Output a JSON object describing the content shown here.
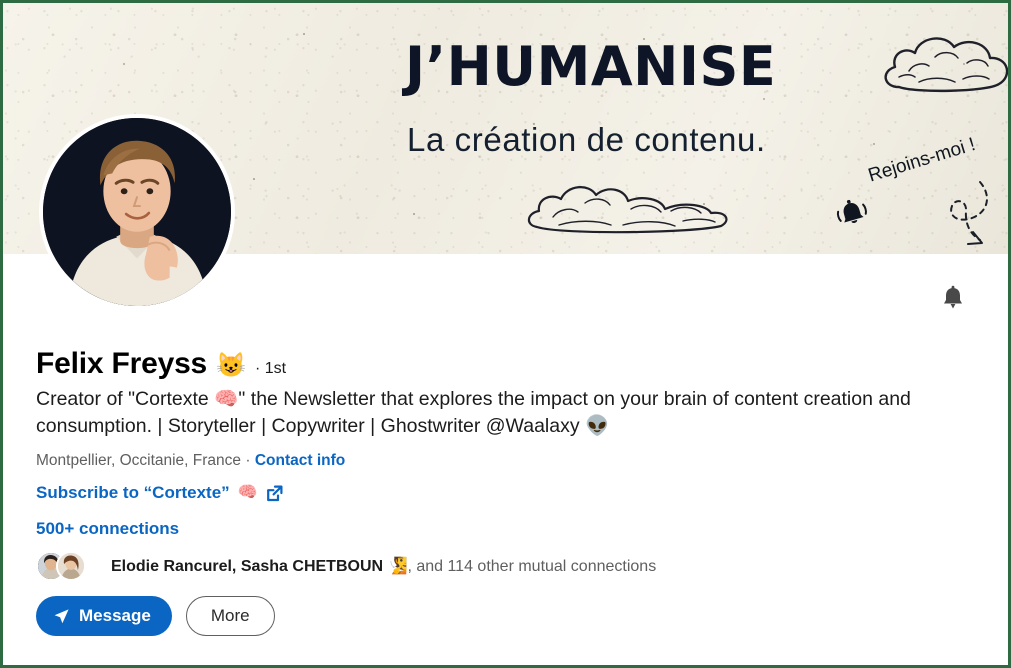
{
  "banner": {
    "title": "J’HUMANISE",
    "subtitle": "La création de contenu.",
    "cta_text": "Rejoins-moi !",
    "bell_icon": "bell-icon",
    "arrow_icon": "curved-dashed-arrow-icon",
    "cloud_icon": "cloud-sketch-icon",
    "background_color": "#f2efe6",
    "title_color": "#0d1526"
  },
  "profile": {
    "avatar_alt": "profile-photo",
    "name": "Felix Freyss",
    "name_emoji": "😺",
    "degree": "· 1st",
    "headline": "Creator of \"Cortexte 🧠\" the Newsletter that explores the impact on your brain of content creation and consumption. | Storyteller | Copywriter | Ghostwriter @Waalaxy 👽",
    "location": "Montpellier, Occitanie, France · ",
    "contact_info_label": "Contact info",
    "subscribe_label": "Subscribe to “Cortexte”",
    "subscribe_emoji": "🧠",
    "external_link_icon": "external-link-icon",
    "connections_label": "500+ connections",
    "notification_bell_icon": "bell-icon",
    "accent_color": "#0a66c2"
  },
  "mutual": {
    "names": "Elodie Rancurel, Sasha CHETBOUN 🧏",
    "suffix": ", and 114 other mutual connections"
  },
  "actions": {
    "message_label": "Message",
    "message_icon": "send-plane-icon",
    "more_label": "More"
  }
}
